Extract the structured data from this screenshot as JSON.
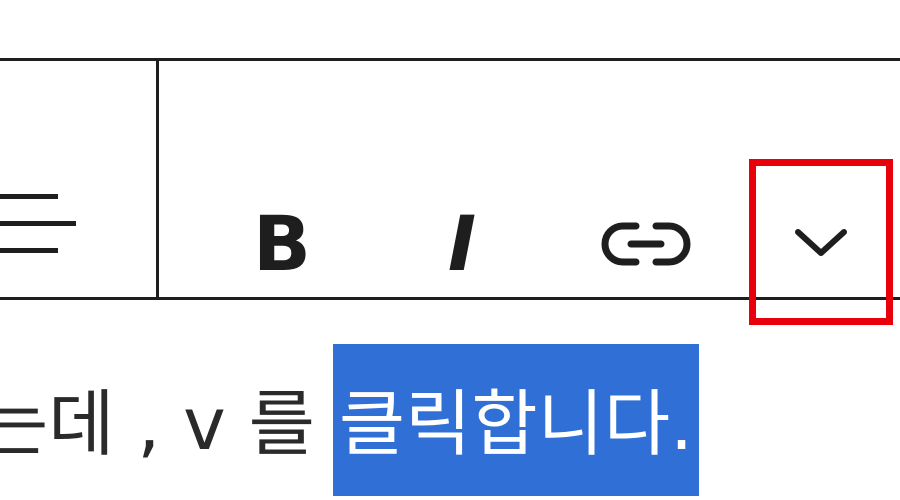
{
  "toolbar": {
    "align_icon": "align-left-icon",
    "bold_label": "B",
    "italic_label": "I",
    "link_icon": "link-icon",
    "more_options_icon": "chevron-down-icon",
    "highlight_color": "#e8000b"
  },
  "content": {
    "leading_text": "는데 , v 를 ",
    "highlighted_text": "클릭합니다.",
    "selection_color": "#2f6fd6"
  }
}
